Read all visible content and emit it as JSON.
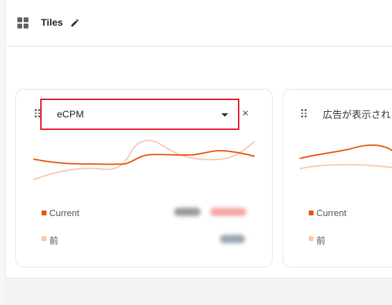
{
  "header": {
    "title": "Tiles",
    "tiles_icon": "grid-icon",
    "edit_icon": "pencil-icon"
  },
  "tiles": [
    {
      "metric_selector": {
        "value": "eCPM",
        "caret_icon": "caret-down-icon"
      },
      "close_label": "×",
      "legend": [
        {
          "label": "Current",
          "color": "#e8540c"
        },
        {
          "label": "前",
          "color": "#f9c8ae"
        }
      ],
      "values_obscured": true
    },
    {
      "title": "広告が表示され",
      "legend": [
        {
          "label": "Current",
          "color": "#e8540c"
        },
        {
          "label": "前",
          "color": "#f9c8ae"
        }
      ]
    }
  ],
  "colors": {
    "accent": "#e8540c",
    "accent_light": "#f9c8ae",
    "highlight_border": "#e0141e"
  }
}
